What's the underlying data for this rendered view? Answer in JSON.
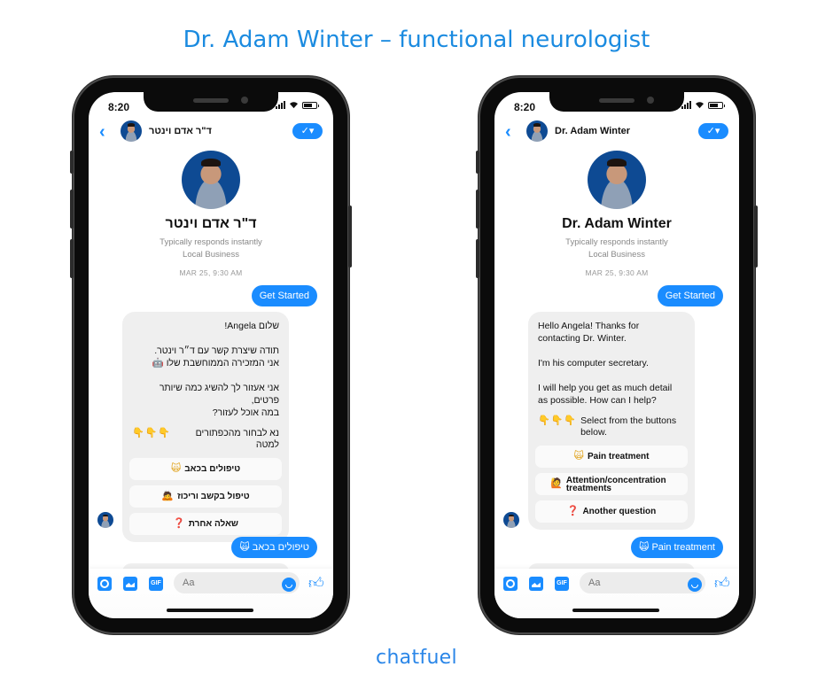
{
  "page_title": "Dr. Adam Winter – functional neurologist",
  "brand": "chatfuel",
  "colors": {
    "accent": "#1a8cff",
    "title": "#1b8be0",
    "bubble": "#efefef"
  },
  "phones": [
    {
      "language": "hebrew",
      "status_time": "8:20",
      "header_name": "ד\"ר אדם וינטר",
      "profile_name": "ד\"ר אדם וינטר",
      "responds": "Typically responds instantly",
      "category": "Local Business",
      "timestamp": "MAR 25, 9:30 AM",
      "get_started": "Get Started",
      "bot_message": "שלום Angela!\n\nתודה שיצרת קשר עם ד״ר וינטר.\nאני המזכירה הממוחשבת שלו 🤖\n\nאני אעזור לך להשיג כמה שיותר פרטים,\nבמה אוכל לעזור?",
      "hint_icon": "👇👇👇",
      "hint_text": "נא לבחור מהכפתורים למטה",
      "quick_replies": [
        {
          "icon": "🙀",
          "icon_name": "cat-icon",
          "label": "טיפולים בכאב"
        },
        {
          "icon": "🙇",
          "icon_name": "person-icon",
          "label": "טיפול בקשב וריכוז"
        },
        {
          "icon": "❓",
          "icon_name": "question-icon",
          "label": "שאלה אחרת"
        }
      ],
      "user_reply_icon": "🙀",
      "user_reply": "טיפולים בכאב",
      "input_placeholder": "Aa",
      "gif_label": "GIF"
    },
    {
      "language": "english",
      "status_time": "8:20",
      "header_name": "Dr. Adam Winter",
      "profile_name": "Dr. Adam Winter",
      "responds": "Typically responds instantly",
      "category": "Local Business",
      "timestamp": "MAR 25, 9:30 AM",
      "get_started": "Get Started",
      "bot_message": "Hello Angela! Thanks for\ncontacting Dr. Winter.\n\nI'm his computer secretary.\n\nI will help you get as much detail\nas possible. How can I help?",
      "hint_icon": "👇👇👇",
      "hint_text": "Select from the buttons below.",
      "quick_replies": [
        {
          "icon": "🙀",
          "icon_name": "cat-icon",
          "label": "Pain treatment"
        },
        {
          "icon": "🙋",
          "icon_name": "person-icon",
          "label": "Attention/concentration treatments"
        },
        {
          "icon": "❓",
          "icon_name": "question-icon",
          "label": "Another question"
        }
      ],
      "user_reply_icon": "🙀",
      "user_reply": "Pain treatment",
      "input_placeholder": "Aa",
      "gif_label": "GIF"
    }
  ]
}
